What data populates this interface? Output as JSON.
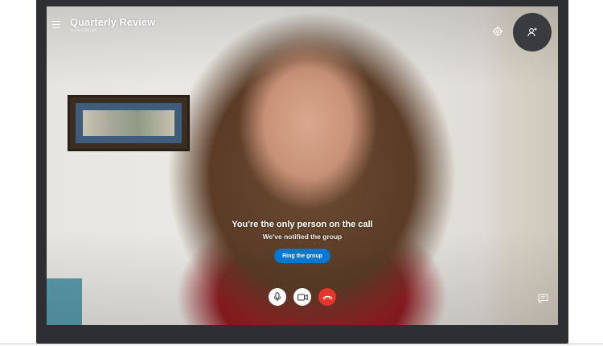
{
  "header": {
    "title": "Quarterly Review",
    "subtitle": "1 of 9 in the call",
    "menu_icon": "hamburger-menu-icon",
    "settings_icon": "gear-icon",
    "add_participant_icon": "add-person-icon"
  },
  "call": {
    "status_message": "You're the only person on the call",
    "notification_message": "We've notified the group",
    "ring_button_label": "Ring the group"
  },
  "controls": {
    "mic_icon": "microphone-icon",
    "video_icon": "video-camera-icon",
    "hangup_icon": "hang-up-icon",
    "chat_icon": "chat-icon"
  },
  "colors": {
    "accent": "#0078d4",
    "hangup": "#e8352b",
    "frame": "#2d2f33"
  }
}
